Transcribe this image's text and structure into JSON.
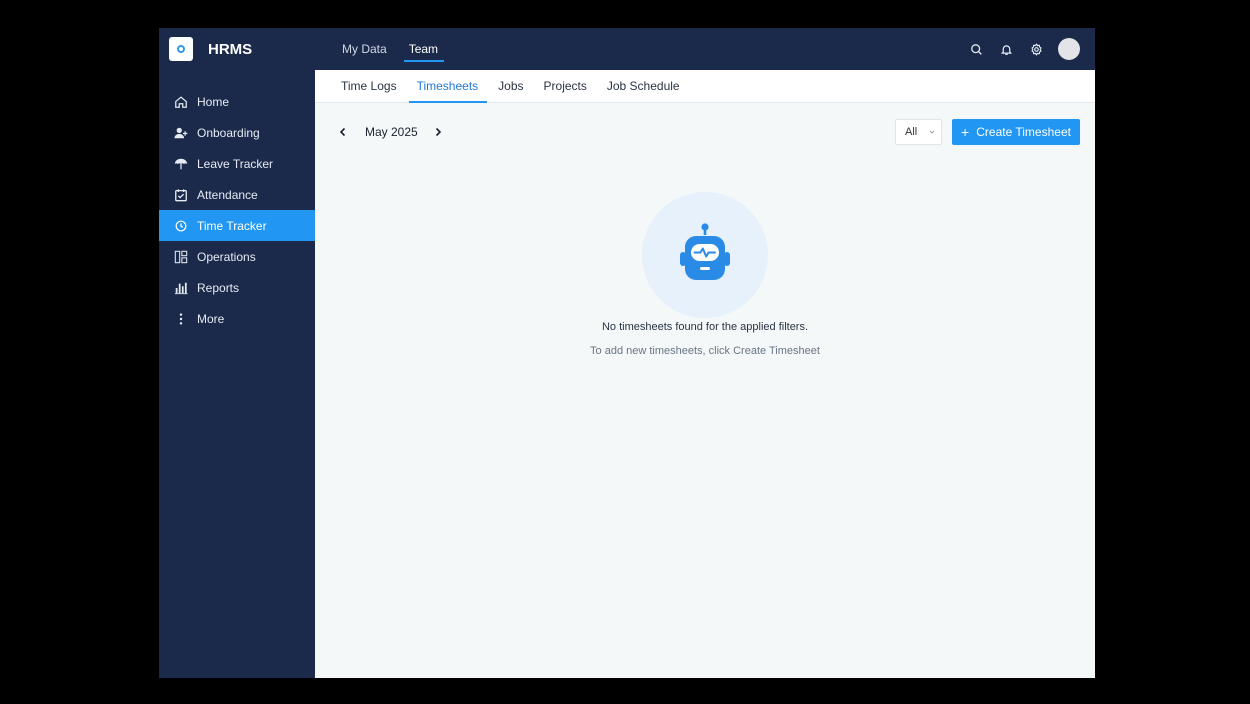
{
  "brand": {
    "name": "HRMS"
  },
  "sidebar": {
    "items": [
      {
        "label": "Home",
        "icon": "home-icon"
      },
      {
        "label": "Onboarding",
        "icon": "user-plus-icon"
      },
      {
        "label": "Leave Tracker",
        "icon": "umbrella-icon"
      },
      {
        "label": "Attendance",
        "icon": "calendar-check-icon"
      },
      {
        "label": "Time Tracker",
        "icon": "clock-icon",
        "active": true
      },
      {
        "label": "Operations",
        "icon": "layout-icon"
      },
      {
        "label": "Reports",
        "icon": "bar-chart-icon"
      },
      {
        "label": "More",
        "icon": "more-vertical-icon"
      }
    ]
  },
  "topbar": {
    "tabs": [
      {
        "label": "My Data"
      },
      {
        "label": "Team",
        "active": true
      }
    ]
  },
  "subtabs": [
    {
      "label": "Time Logs"
    },
    {
      "label": "Timesheets",
      "active": true
    },
    {
      "label": "Jobs"
    },
    {
      "label": "Projects"
    },
    {
      "label": "Job Schedule"
    }
  ],
  "toolbar": {
    "month": "May 2025",
    "filter_value": "All",
    "create_label": "Create Timesheet"
  },
  "empty_state": {
    "title": "No timesheets found for the applied filters.",
    "subtitle": "To add new timesheets, click Create Timesheet",
    "icon": "robot-icon"
  },
  "colors": {
    "sidebar_bg": "#1b2a4a",
    "accent": "#2196f3",
    "content_bg": "#f4f8f9"
  }
}
